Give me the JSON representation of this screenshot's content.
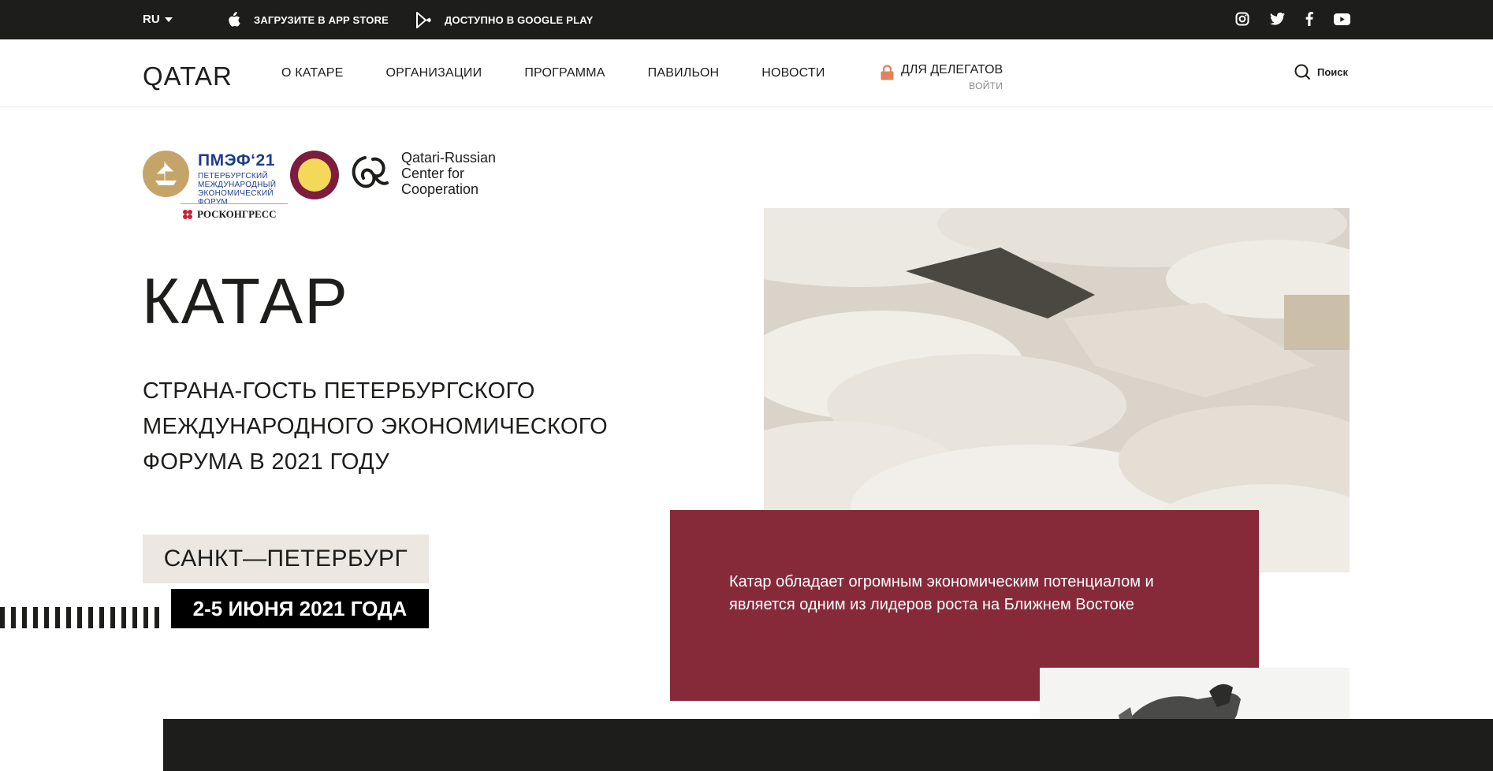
{
  "topbar": {
    "lang": "RU",
    "app_store": "ЗАГРУЗИТЕ В APP STORE",
    "google_play": "ДОСТУПНО В GOOGLE PLAY",
    "socials": [
      "instagram-icon",
      "twitter-icon",
      "facebook-icon",
      "youtube-icon"
    ]
  },
  "nav": {
    "logo": "QATAR",
    "items": [
      "О КАТАРЕ",
      "ОРГАНИЗАЦИИ",
      "ПРОГРАММА",
      "ПАВИЛЬОН",
      "НОВОСТИ"
    ],
    "delegates": {
      "label": "ДЛЯ ДЕЛЕГАТОВ",
      "login": "ВОЙТИ"
    },
    "search": "Поиск"
  },
  "logos": {
    "spief_name": "ПМЭФ‘21",
    "spief_text": "ПЕТЕРБУРГСКИЙ МЕЖДУНАРОДНЫЙ ЭКОНОМИЧЕСКИЙ ФОРУМ",
    "roscongress": "РОСКОНГРЕСС",
    "center": "Qatari-Russian Center for Cooperation"
  },
  "hero": {
    "title": "КАТАР",
    "subtitle": "СТРАНА-ГОСТЬ ПЕТЕРБУРГСКОГО МЕЖДУНАРОДНОГО ЭКОНОМИЧЕСКОГО ФОРУМА В 2021 ГОДУ",
    "city": "САНКТ—ПЕТЕРБУРГ",
    "dates": "2-5 ИЮНЯ 2021 ГОДА",
    "quote": "Катар обладает огромным экономическим потенциалом и является одним из лидеров роста на Ближнем Востоке"
  },
  "colors": {
    "dark": "#1d1d1b",
    "accent": "#862a3a",
    "beige": "#ece7e1",
    "lock": "#e2825a",
    "spief_blue": "#1f3c8f",
    "gold": "#c5a46a"
  }
}
